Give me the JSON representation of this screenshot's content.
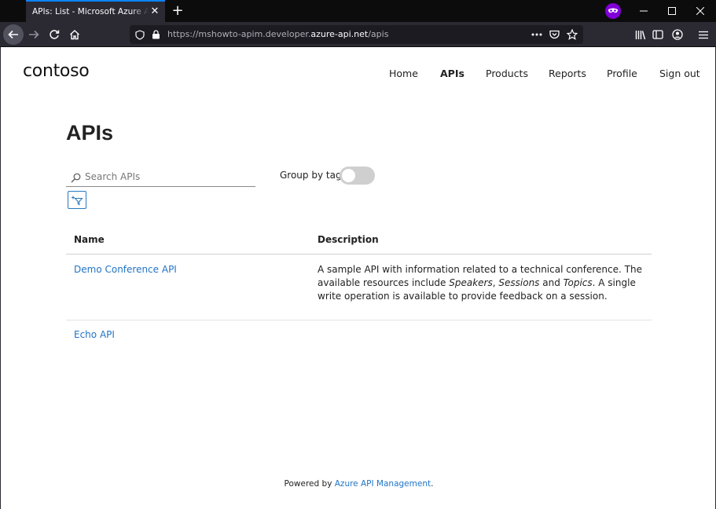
{
  "browser": {
    "tab_title": "APIs: List - Microsoft Azure API Management",
    "url_prefix": "https://mshowto-apim.developer.",
    "url_host": "azure-api.net",
    "url_path": "/apis"
  },
  "site": {
    "logo": "contoso",
    "nav": [
      {
        "label": "Home"
      },
      {
        "label": "APIs"
      },
      {
        "label": "Products"
      },
      {
        "label": "Reports"
      },
      {
        "label": "Profile"
      },
      {
        "label": "Sign out"
      }
    ]
  },
  "main": {
    "title": "APIs",
    "search_placeholder": "Search APIs",
    "group_by_tag_label": "Group by tag",
    "group_by_tag_on": false,
    "table": {
      "headers": {
        "name": "Name",
        "description": "Description"
      },
      "rows": [
        {
          "name": "Demo Conference API",
          "description_parts": [
            "A sample API with information related to a technical conference. The available resources include ",
            "Speakers",
            ", ",
            "Sessions",
            " and ",
            "Topics",
            ". A single write operation is available to provide feedback on a session."
          ]
        },
        {
          "name": "Echo API",
          "description_parts": []
        }
      ]
    }
  },
  "footer": {
    "prefix": "Powered by ",
    "link": "Azure API Management",
    "suffix": "."
  },
  "colors": {
    "link": "#2274c5",
    "accent": "#0a84ff",
    "private_badge": "#8000d7"
  }
}
